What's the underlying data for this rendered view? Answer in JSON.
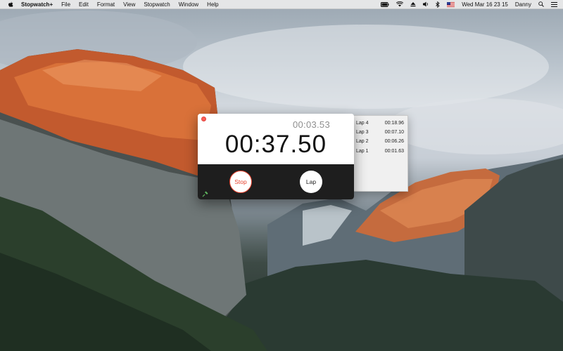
{
  "menubar": {
    "app_name": "Stopwatch+",
    "menus": [
      "File",
      "Edit",
      "Format",
      "View",
      "Stopwatch",
      "Window",
      "Help"
    ],
    "clock": "Wed Mar 16  23 15",
    "user": "Danny",
    "status_icons": [
      "battery-icon",
      "wifi-icon",
      "eject-icon",
      "volume-icon",
      "bluetooth-icon",
      "flag-us-icon",
      "search-icon",
      "list-icon"
    ]
  },
  "stopwatch": {
    "lap_time": "00:03.53",
    "main_time": "00:37.50",
    "stop_label": "Stop",
    "lap_label": "Lap"
  },
  "laps": [
    {
      "label": "Lap 4",
      "time": "00:18.96"
    },
    {
      "label": "Lap 3",
      "time": "00:07.10"
    },
    {
      "label": "Lap 2",
      "time": "00:06.26"
    },
    {
      "label": "Lap 1",
      "time": "00:01.63"
    }
  ],
  "colors": {
    "stop_red": "#e8432e",
    "close_red": "#fc5f57",
    "control_bar": "#1e1e1e"
  }
}
